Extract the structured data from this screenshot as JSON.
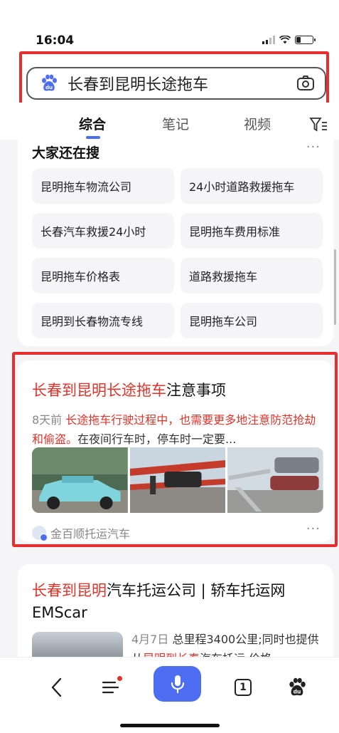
{
  "status": {
    "time": "16:04"
  },
  "search": {
    "query": "长春到昆明长途拖车"
  },
  "tabs": [
    {
      "label": "综合"
    },
    {
      "label": "笔记"
    },
    {
      "label": "视频"
    }
  ],
  "related": {
    "title": "大家还在搜",
    "more": "···",
    "items": [
      "昆明拖车物流公司",
      "24小时道路救援拖车",
      "长春汽车救援24小时",
      "昆明拖车费用标准",
      "昆明拖车价格表",
      "道路救援拖车",
      "昆明到长春物流专线",
      "昆明拖车公司"
    ]
  },
  "result1": {
    "title_hl": "长春到昆明长途拖车",
    "title_rest": "注意事项",
    "age": "8天前",
    "snippet_hl": "长途拖车行驶过程中，也需要更多地注意防范抢劫和偷盗。",
    "snippet_rest": "在夜间行车时，停车时一定要...",
    "source": "金百顺托运汽车",
    "more": "···"
  },
  "result2": {
    "title_hl": "长春到昆明",
    "title_rest": "汽车托运公司 | 轿车托运网 EMScar",
    "age": "4月7日",
    "snippet_1": "总里程3400公里;同时也提供从",
    "snippet_hl": "昆明到长春",
    "snippet_2": "汽车托运,价格"
  },
  "bottom_bar": {
    "tab_count": "1"
  },
  "colors": {
    "accent": "#4e6ef2",
    "highlight": "#e0332a"
  }
}
